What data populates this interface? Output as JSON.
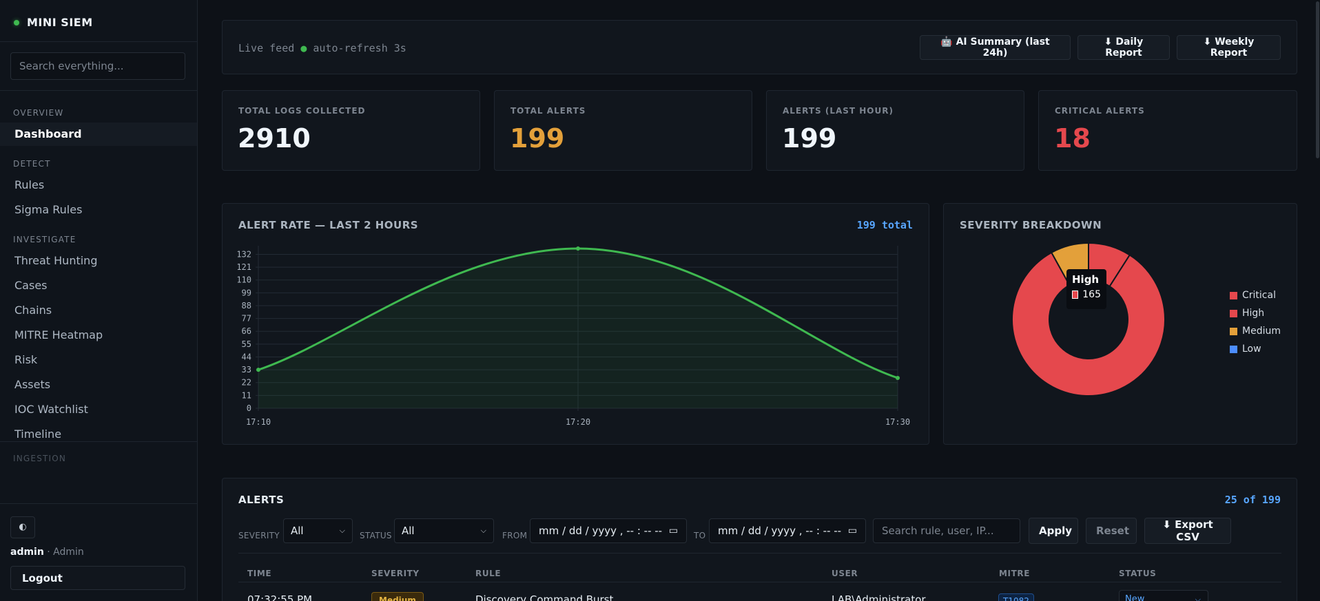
{
  "brand": {
    "name": "MINI SIEM"
  },
  "search": {
    "placeholder": "Search everything..."
  },
  "nav": {
    "sections": [
      "OVERVIEW",
      "DETECT",
      "INVESTIGATE",
      "INGESTION"
    ],
    "items": [
      "Dashboard",
      "Rules",
      "Sigma Rules",
      "Threat Hunting",
      "Cases",
      "Chains",
      "MITRE Heatmap",
      "Risk",
      "Assets",
      "IOC Watchlist",
      "Timeline"
    ],
    "active": "Dashboard"
  },
  "user": {
    "name": "admin",
    "role": " · Admin",
    "logout": "Logout",
    "theme_icon": "◐"
  },
  "topbar": {
    "live_text": "Live feed",
    "live_dot": "●",
    "refresh_text": "auto-refresh 3s",
    "ai_icon": "🤖",
    "ai_label": "AI Summary (last 24h)",
    "daily_label": "⬇ Daily Report",
    "weekly_label": "⬇ Weekly Report"
  },
  "stats": [
    {
      "label": "TOTAL LOGS COLLECTED",
      "value": "2910",
      "color": "#f0f6fc"
    },
    {
      "label": "TOTAL ALERTS",
      "value": "199",
      "color": "#e3a03a"
    },
    {
      "label": "ALERTS (LAST HOUR)",
      "value": "199",
      "color": "#f0f6fc"
    },
    {
      "label": "CRITICAL ALERTS",
      "value": "18",
      "color": "#e5484d"
    }
  ],
  "rate_chart": {
    "title": "ALERT RATE — LAST 2 HOURS",
    "total_label": "199 total"
  },
  "severity_chart": {
    "title": "SEVERITY BREAKDOWN",
    "tooltip_title": "High",
    "tooltip_value": "165"
  },
  "chart_data": [
    {
      "type": "line",
      "title": "ALERT RATE — LAST 2 HOURS",
      "x": [
        "17:10",
        "17:20",
        "17:30"
      ],
      "series": [
        {
          "values": [
            33,
            137,
            26
          ]
        }
      ],
      "yticks": [
        0,
        11,
        22,
        33,
        44,
        55,
        66,
        77,
        88,
        99,
        110,
        121,
        132
      ],
      "ylim": [
        0,
        137
      ],
      "color": "#3fb950",
      "grid": true,
      "area": true
    },
    {
      "type": "pie",
      "donut": true,
      "title": "SEVERITY BREAKDOWN",
      "labels": [
        "Critical",
        "High",
        "Medium",
        "Low"
      ],
      "values": [
        18,
        165,
        16,
        0
      ],
      "colors": [
        "#e5484d",
        "#e5484d",
        "#e3a03a",
        "#4c8dff"
      ],
      "legend": "right"
    }
  ],
  "alerts": {
    "title": "ALERTS",
    "count_label": "25 of 199",
    "filters": {
      "severity_label": "SEVERITY",
      "severity_value": "All",
      "status_label": "STATUS",
      "status_value": "All",
      "from_label": "FROM",
      "to_label": "TO",
      "date_placeholder": "mm / dd / yyyy ,  -- : --   --",
      "search_placeholder": "Search rule, user, IP...",
      "apply": "Apply",
      "reset": "Reset",
      "export": "⬇ Export CSV"
    },
    "columns": [
      "TIME",
      "SEVERITY",
      "RULE",
      "USER",
      "MITRE",
      "STATUS"
    ],
    "rows": [
      {
        "time": "07:32:55 PM",
        "severity": "Medium",
        "rule": "Discovery Command Burst",
        "user": "LAB\\Administrator",
        "mitre": "T1082",
        "status": "New"
      }
    ]
  }
}
